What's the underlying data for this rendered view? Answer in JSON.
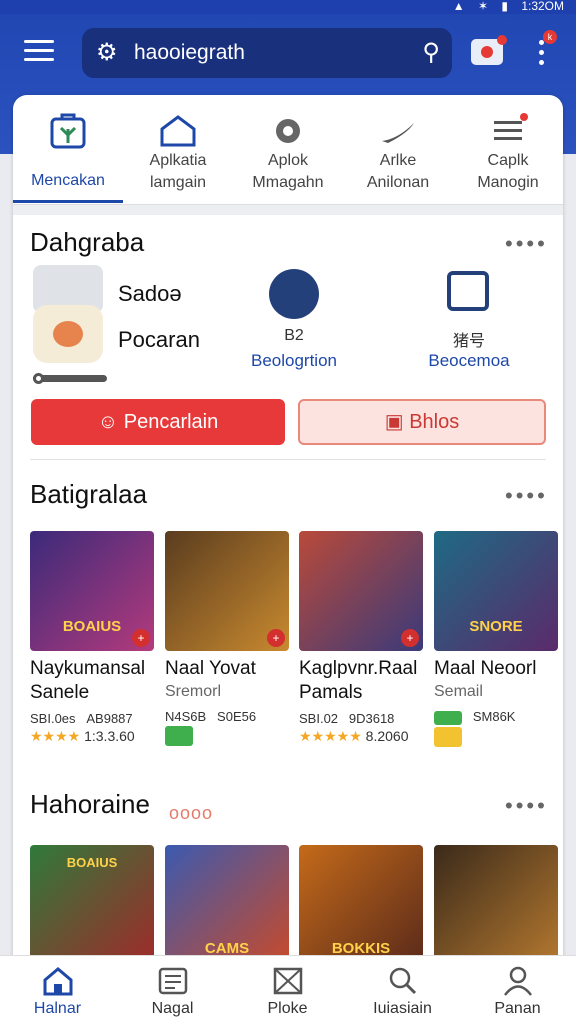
{
  "status": {
    "icons": [
      "signal-icon",
      "wifi-icon",
      "battery-icon"
    ],
    "time": "1:32OM"
  },
  "header": {
    "search_text": "haooiegrath",
    "menu_icon": "menu-icon",
    "camera_icon": "camera-icon",
    "more_icon": "more-vert-icon"
  },
  "categories": [
    {
      "label1": "Mencakan",
      "label2": "",
      "icon": "bag-icon",
      "active": true
    },
    {
      "label1": "Aplkatia",
      "label2": "lamgain",
      "icon": "house-icon"
    },
    {
      "label1": "Aplok",
      "label2": "Mmagahn",
      "icon": "gear-icon"
    },
    {
      "label1": "Arlke",
      "label2": "Anilonan",
      "icon": "shoe-icon"
    },
    {
      "label1": "Caplk",
      "label2": "Manogin",
      "icon": "list-icon"
    }
  ],
  "section1": {
    "title": "Dahgraba",
    "items": [
      {
        "name": "Sadoə"
      },
      {
        "name": "Pocaran"
      }
    ],
    "features": [
      {
        "label": "Beologrtion",
        "sub": "B2",
        "icon": "book-icon"
      },
      {
        "label": "Beocemoa",
        "sub": "猪号",
        "icon": "image-icon"
      }
    ],
    "button_primary": "Pencarlain",
    "button_secondary": "Bhlos"
  },
  "section2": {
    "title": "Batigralaa",
    "games": [
      {
        "title1": "Naykumansal",
        "title2": "Sanele",
        "sub": "",
        "meta1": "SBI.0es",
        "meta2": "AB9887",
        "rating": "★★★★",
        "rating_val": "1:3.3.60",
        "img_text": "BOAIUS",
        "colors": [
          "#3b2a7a",
          "#b43a7c"
        ]
      },
      {
        "title1": "Naal Yovat",
        "title2": "",
        "sub": "Sremorl",
        "meta1": "N4S6B",
        "meta2": "S0E56",
        "rating": "",
        "rating_val": "",
        "badge_color": "#3fae4c",
        "img_text": "",
        "colors": [
          "#5a3c1f",
          "#c98a2f"
        ]
      },
      {
        "title1": "Kaglpvnr.Raal",
        "title2": "Pamals",
        "sub": "",
        "meta1": "SBI.02",
        "meta2": "9D3618",
        "rating": "★★★★★",
        "rating_val": "8.2060",
        "img_text": "",
        "colors": [
          "#b94a3a",
          "#3a3a7a"
        ]
      },
      {
        "title1": "Maal Neoorl",
        "title2": "",
        "sub": "Semail",
        "meta1": "",
        "meta2": "SM86K",
        "rating": "",
        "rating_val": "",
        "badge_color": "#f2c230",
        "img_text": "SNORE",
        "colors": [
          "#1e6a84",
          "#5b2a6a"
        ]
      }
    ]
  },
  "section3": {
    "title": "Hahoraine",
    "mini": "oooo",
    "games": [
      {
        "img_text": "BOAIUS",
        "colors": [
          "#2f7a3a",
          "#a02a2a"
        ]
      },
      {
        "img_text": "CAMS",
        "colors": [
          "#3b5ab0",
          "#c84a2a"
        ]
      },
      {
        "img_text": "BOKKIS",
        "colors": [
          "#c46a1a",
          "#5a2a1a"
        ]
      },
      {
        "img_text": "",
        "colors": [
          "#3a2a1a",
          "#b4782f"
        ]
      }
    ]
  },
  "bottom_nav": [
    {
      "label": "Halnar",
      "icon": "home-icon",
      "active": true
    },
    {
      "label": "Nagal",
      "icon": "news-icon"
    },
    {
      "label": "Ploke",
      "icon": "box-icon"
    },
    {
      "label": "Iuiasiain",
      "icon": "search-icon"
    },
    {
      "label": "Panan",
      "icon": "profile-icon"
    }
  ],
  "colors": {
    "primary": "#2147b3",
    "accent_red": "#e8393a",
    "active": "#1e48a8"
  }
}
